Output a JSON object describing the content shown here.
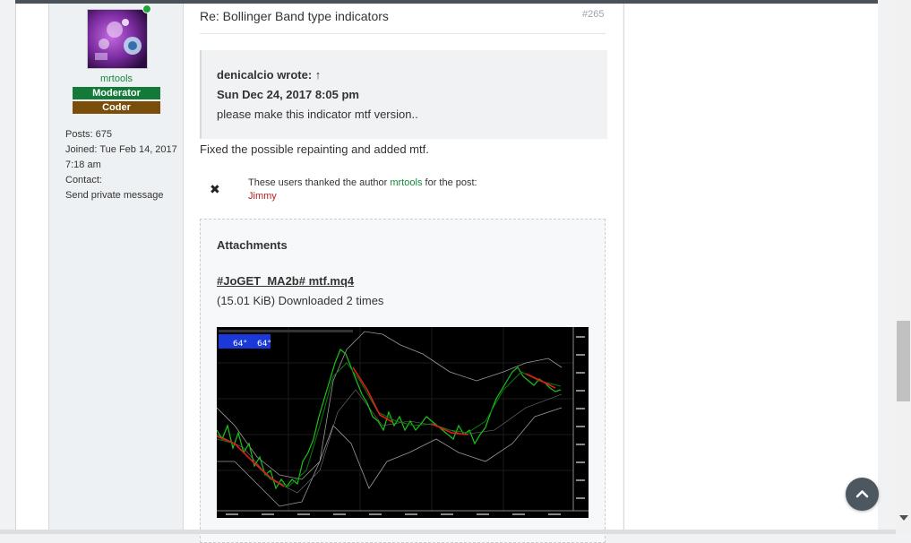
{
  "profile": {
    "username": "mrtools",
    "rank_moderator": "Moderator",
    "rank_coder": "Coder",
    "posts_label": "Posts:",
    "posts_value": "675",
    "joined_label": "Joined:",
    "joined_value": "Tue Feb 14, 2017 7:18 am",
    "contact_label": "Contact:",
    "send_pm": "Send private message"
  },
  "post": {
    "title": "Re: Bollinger Band type indicators",
    "number": "#265",
    "quote_author": "denicalcio wrote: ↑",
    "quote_date": "Sun Dec 24, 2017 8:05 pm",
    "quote_text": "please make this indicator mtf version..",
    "body": "Fixed the possible repainting and added mtf."
  },
  "thanks": {
    "prefix": "These users thanked the author",
    "author": "mrtools",
    "suffix": "for the post:",
    "user": "Jimmy"
  },
  "attachments": {
    "title": "Attachments",
    "file_name": "#JoGET_MA2b# mtf.mq4",
    "file_meta": "(15.01 KiB) Downloaded 2 times"
  },
  "chart": {
    "panel_values": [
      "64°",
      "64°"
    ]
  },
  "icons": {
    "close": "close-icon",
    "back_to_top": "chevron-up-icon"
  },
  "colors": {
    "online": "#1fa63a",
    "moderator_bg": "#147a38",
    "coder_bg": "#7a4d0a",
    "username": "#138a3a",
    "thanked_user": "#b22222"
  }
}
